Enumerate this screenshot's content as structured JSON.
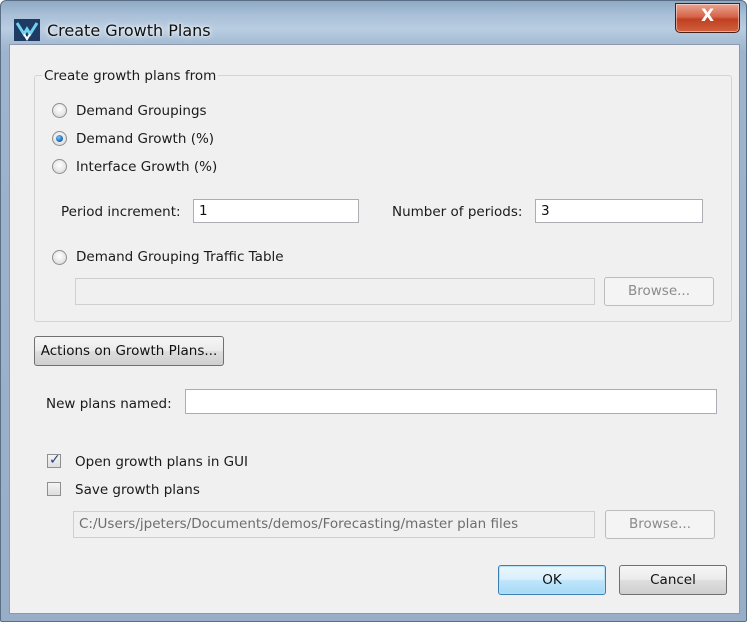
{
  "window": {
    "title": "Create Growth Plans",
    "close_glyph": "X"
  },
  "source_group": {
    "label": "Create growth plans from",
    "options": [
      {
        "label": "Demand Groupings",
        "checked": false
      },
      {
        "label": "Demand Growth (%)",
        "checked": true
      },
      {
        "label": "Interface Growth (%)",
        "checked": false
      },
      {
        "label": "Demand Grouping Traffic Table",
        "checked": false
      }
    ],
    "period_increment": {
      "label": "Period increment:",
      "value": "1"
    },
    "number_of_periods": {
      "label": "Number of periods:",
      "value": "3"
    },
    "traffic_table_path": "",
    "browse_label": "Browse..."
  },
  "actions_button": {
    "label": "Actions on Growth Plans..."
  },
  "new_plans": {
    "label": "New plans named:",
    "value": ""
  },
  "open_in_gui": {
    "label": "Open growth plans in GUI",
    "checked": true
  },
  "save_plans": {
    "label": "Save growth plans",
    "checked": false,
    "path": "C:/Users/jpeters/Documents/demos/Forecasting/master plan files",
    "browse_label": "Browse..."
  },
  "footer": {
    "ok_label": "OK",
    "cancel_label": "Cancel"
  },
  "icons": {
    "app": "app-logo-icon",
    "close": "close-icon",
    "check": "check-icon"
  }
}
